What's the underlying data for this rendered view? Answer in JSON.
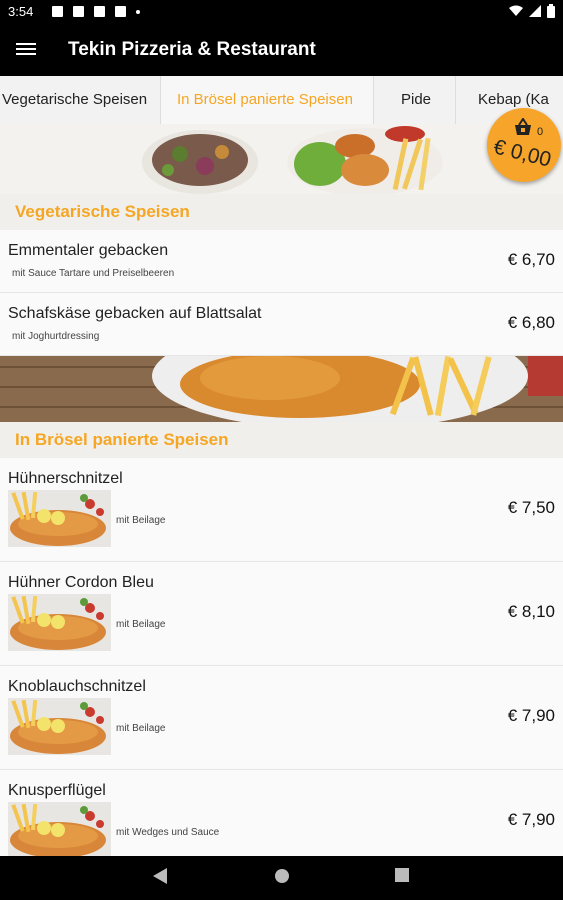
{
  "status": {
    "time": "3:54"
  },
  "appbar": {
    "title": "Tekin Pizzeria & Restaurant"
  },
  "tabs": [
    {
      "label": "Vegetarische Speisen"
    },
    {
      "label": "In Brösel panierte Speisen"
    },
    {
      "label": "Pide"
    },
    {
      "label": "Kebap (Ka"
    }
  ],
  "cart": {
    "count": "0",
    "total": "€ 0,00"
  },
  "sections": [
    {
      "title": "Vegetarische Speisen",
      "items": [
        {
          "name": "Emmentaler gebacken",
          "desc": "mit Sauce Tartare und Preiselbeeren",
          "price": "€ 6,70"
        },
        {
          "name": "Schafskäse gebacken auf Blattsalat",
          "desc": "mit Joghurtdressing",
          "price": "€ 6,80"
        }
      ]
    },
    {
      "title": "In Brösel panierte Speisen",
      "items": [
        {
          "name": "Hühnerschnitzel",
          "desc": "mit Beilage",
          "price": "€ 7,50"
        },
        {
          "name": "Hühner Cordon Bleu",
          "desc": "mit Beilage",
          "price": "€ 8,10"
        },
        {
          "name": "Knoblauchschnitzel",
          "desc": "mit Beilage",
          "price": "€ 7,90"
        },
        {
          "name": "Knusperflügel",
          "desc": "mit Wedges und Sauce",
          "price": "€ 7,90"
        }
      ]
    }
  ],
  "colors": {
    "accent": "#f5a623",
    "bar": "#000000"
  }
}
